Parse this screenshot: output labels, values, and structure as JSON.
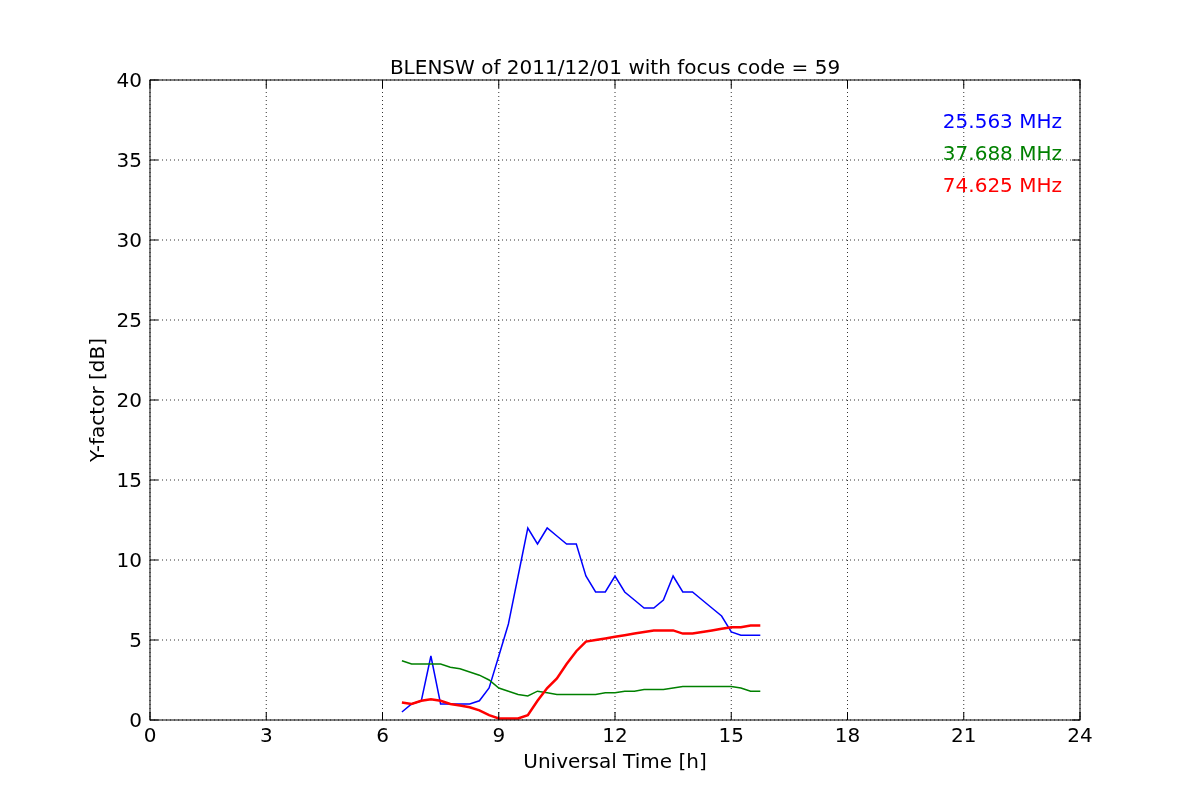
{
  "chart_data": {
    "type": "line",
    "title": "BLENSW of 2011/12/01 with focus code = 59",
    "xlabel": "Universal Time [h]",
    "ylabel": "Y-factor [dB]",
    "grid": true,
    "xlim": [
      0,
      24
    ],
    "ylim": [
      0,
      40
    ],
    "xticks": [
      0,
      3,
      6,
      9,
      12,
      15,
      18,
      21,
      24
    ],
    "yticks": [
      0,
      5,
      10,
      15,
      20,
      25,
      30,
      35,
      40
    ],
    "x": [
      6.5,
      6.75,
      7,
      7.25,
      7.5,
      7.75,
      8,
      8.25,
      8.5,
      8.75,
      9,
      9.25,
      9.5,
      9.75,
      10,
      10.25,
      10.5,
      10.75,
      11,
      11.25,
      11.5,
      11.75,
      12,
      12.25,
      12.5,
      12.75,
      13,
      13.25,
      13.5,
      13.75,
      14,
      14.25,
      14.5,
      14.75,
      15,
      15.25,
      15.5,
      15.75
    ],
    "series": [
      {
        "name": "25.563 MHz",
        "color": "#0000ff",
        "values": [
          0.5,
          1,
          1.2,
          4,
          1,
          1,
          1,
          1,
          1.2,
          2,
          4,
          6,
          9,
          12,
          11,
          12,
          11.5,
          11,
          11,
          9,
          8,
          8,
          9,
          8,
          7.5,
          7,
          7,
          7.5,
          9,
          8,
          8,
          7.5,
          7,
          6.5,
          5.5,
          5.3,
          5.3,
          5.3
        ]
      },
      {
        "name": "37.688 MHz",
        "color": "#008000",
        "values": [
          3.7,
          3.5,
          3.5,
          3.5,
          3.5,
          3.3,
          3.2,
          3,
          2.8,
          2.5,
          2,
          1.8,
          1.6,
          1.5,
          1.8,
          1.7,
          1.6,
          1.6,
          1.6,
          1.6,
          1.6,
          1.7,
          1.7,
          1.8,
          1.8,
          1.9,
          1.9,
          1.9,
          2,
          2.1,
          2.1,
          2.1,
          2.1,
          2.1,
          2.1,
          2,
          1.8,
          1.8
        ]
      },
      {
        "name": "74.625 MHz",
        "color": "#ff0000",
        "values": [
          1.1,
          1,
          1.2,
          1.3,
          1.2,
          1,
          0.9,
          0.8,
          0.6,
          0.3,
          0.1,
          0.1,
          0.1,
          0.3,
          1.2,
          2,
          2.6,
          3.5,
          4.3,
          4.9,
          5,
          5.1,
          5.2,
          5.3,
          5.4,
          5.5,
          5.6,
          5.6,
          5.6,
          5.4,
          5.4,
          5.5,
          5.6,
          5.7,
          5.8,
          5.8,
          5.9,
          5.9
        ]
      }
    ]
  }
}
